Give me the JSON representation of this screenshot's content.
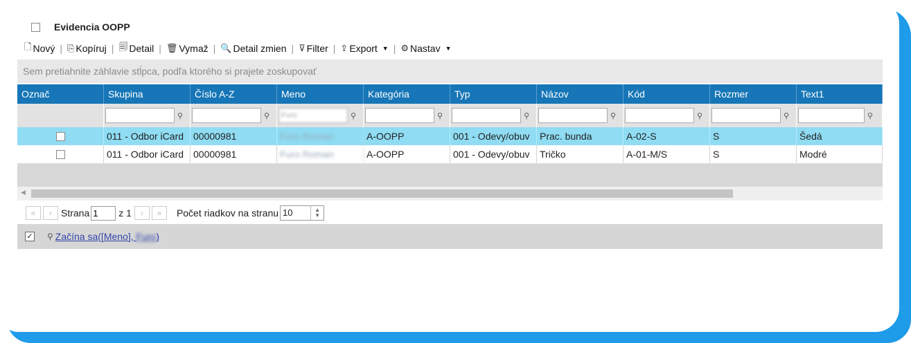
{
  "window": {
    "title": "Evidencia OOPP"
  },
  "toolbar": {
    "items": [
      {
        "icon": "new-document-icon",
        "glyph": "🗋",
        "label": "Nový"
      },
      {
        "icon": "copy-icon",
        "glyph": "⎘",
        "label": "Kopíruj"
      },
      {
        "icon": "detail-icon",
        "glyph": "🗐",
        "label": "Detail"
      },
      {
        "icon": "trash-icon",
        "glyph": "🗑",
        "label": "Vymaž"
      },
      {
        "icon": "search-changes-icon",
        "glyph": "🔍",
        "label": "Detail zmien"
      },
      {
        "icon": "filter-icon",
        "glyph": "⊽",
        "label": "Filter"
      },
      {
        "icon": "export-icon",
        "glyph": "⇪",
        "label": "Export"
      },
      {
        "icon": "gear-icon",
        "glyph": "⚙",
        "label": "Nastav"
      }
    ]
  },
  "groupbar": {
    "text": "Sem pretiahnite záhlavie stĺpca, podľa ktorého si prajete zoskupovať"
  },
  "grid": {
    "columns": [
      "Označ",
      "Skupina",
      "Číslo A-Z",
      "Meno",
      "Kategória",
      "Typ",
      "Názov",
      "Kód",
      "Rozmer",
      "Text1"
    ],
    "filter_meno_value": "Furo",
    "rows": [
      {
        "selected": true,
        "cells": [
          "",
          "011 - Odbor iCard",
          "00000981",
          "Furo Roman",
          "A-OOPP",
          "001 - Odevy/obuv",
          "Prac. bunda",
          "A-02-S",
          "S",
          "Šedá"
        ]
      },
      {
        "selected": false,
        "cells": [
          "",
          "011 - Odbor iCard",
          "00000981",
          "Furo Roman",
          "A-OOPP",
          "001 - Odevy/obuv",
          "Tričko",
          "A-01-M/S",
          "S",
          "Modré"
        ]
      }
    ]
  },
  "pager": {
    "page_label": "Strana",
    "page_value": "1",
    "of_label": "z 1",
    "rows_label": "Počet riadkov na stranu",
    "rows_value": "10"
  },
  "filter_status": {
    "checked": true,
    "expression_prefix": "Začína sa([Meno], ",
    "expression_value": "Furo",
    "expression_suffix": ")"
  },
  "colors": {
    "header": "#1676b7",
    "selected_row": "#8fdcf3",
    "frame": "#1e9be9"
  }
}
